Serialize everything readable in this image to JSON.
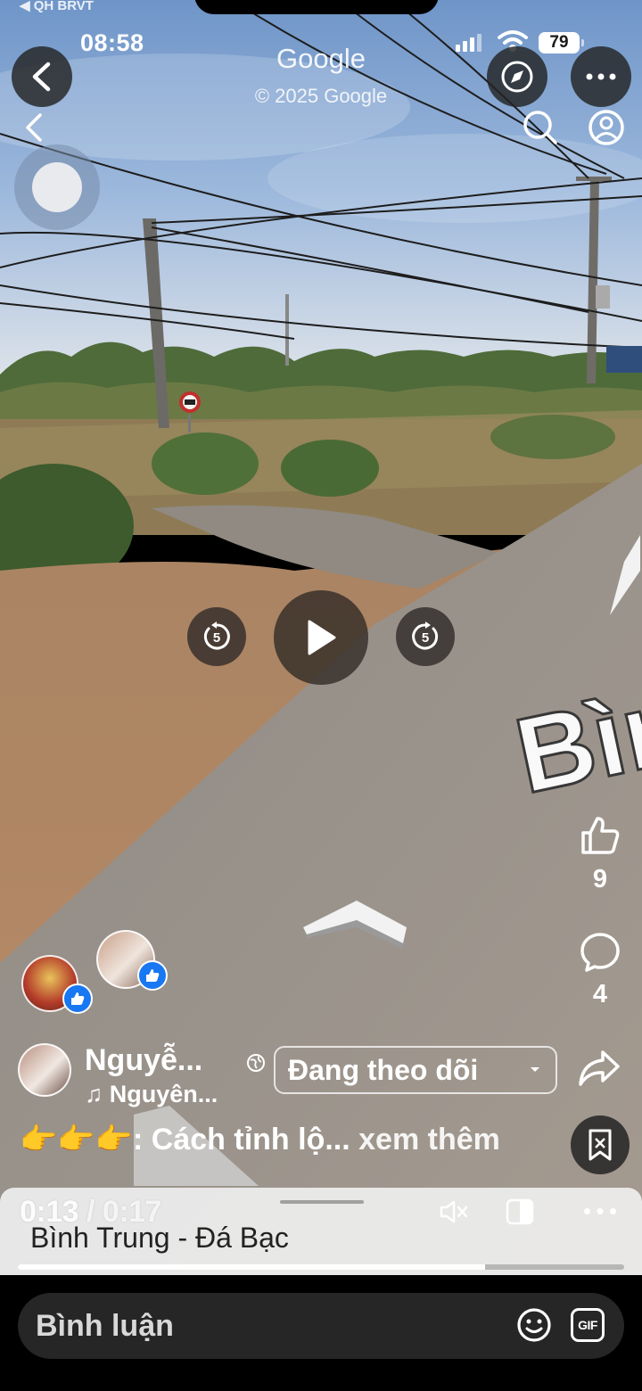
{
  "status_bar": {
    "back_app": "◀ QH BRVT",
    "time": "08:58",
    "battery": "79"
  },
  "street_view": {
    "google_label": "Google",
    "copyright": "© 2025 Google",
    "road_label": "Bình T"
  },
  "player": {
    "current_time": "0:13",
    "separator": " / ",
    "duration": "0:17",
    "progress": 0.77,
    "skip_back_label": "5",
    "skip_forward_label": "5"
  },
  "reactions": {
    "like_count": "9",
    "comment_count": "4"
  },
  "post": {
    "author_name": "Nguyễ...",
    "audio": "♫ Nguyên...",
    "follow_label": "Đang theo dõi",
    "caption_emoji": "👉👉👉",
    "caption_text": ": Cách tỉnh lộ...",
    "see_more": " xem thêm"
  },
  "sheet": {
    "title": "Bình Trung - Đá Bạc"
  },
  "comment_bar": {
    "placeholder": "Bình luận",
    "gif_label": "GIF"
  },
  "icons": {
    "back": "back-arrow-icon",
    "compass": "compass-icon",
    "more": "more-horizontal-icon",
    "search": "search-icon",
    "profile": "profile-icon",
    "like": "thumbs-up-icon",
    "comment": "comment-bubble-icon",
    "share": "share-arrow-icon",
    "bookmark": "bookmark-icon",
    "mute": "speaker-mute-icon",
    "pip": "picture-in-picture-icon",
    "emoji": "smiley-icon",
    "gif": "gif-icon"
  },
  "colors": {
    "sky": "#8fb0d8",
    "road": "#9a9188",
    "dirt": "#b88a66",
    "like_blue": "#1877f2"
  }
}
